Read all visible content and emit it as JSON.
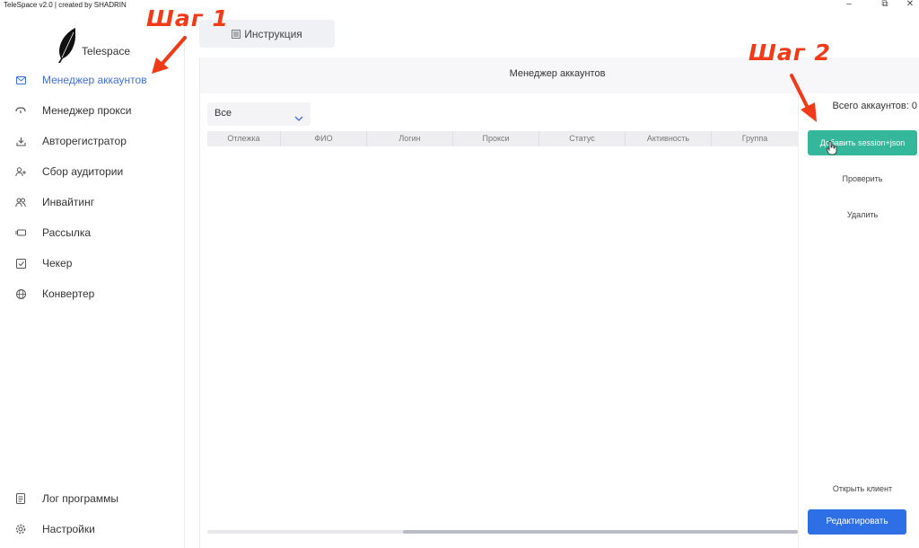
{
  "window": {
    "title": "TeleSpace v2.0 | created by SHADRIN",
    "minimize_glyph": "–",
    "maximize_glyph": "⧉",
    "close_glyph": "✕"
  },
  "app": {
    "name": "Telespace",
    "logo_icon": "feather-icon"
  },
  "top_tab": {
    "label": "Инструкция",
    "icon": "list-icon"
  },
  "sidebar": {
    "items": [
      {
        "label": "Менеджер аккаунтов",
        "icon": "mail-icon",
        "active": true
      },
      {
        "label": "Менеджер прокси",
        "icon": "proxy-icon"
      },
      {
        "label": "Авторегистратор",
        "icon": "download-icon"
      },
      {
        "label": "Сбор аудитории",
        "icon": "add-user-icon"
      },
      {
        "label": "Инвайтинг",
        "icon": "users-icon"
      },
      {
        "label": "Рассылка",
        "icon": "send-icon"
      },
      {
        "label": "Чекер",
        "icon": "checkbox-icon"
      },
      {
        "label": "Конвертер",
        "icon": "globe-icon"
      }
    ],
    "bottom_items": [
      {
        "label": "Лог программы",
        "icon": "log-icon"
      },
      {
        "label": "Настройки",
        "icon": "gear-icon"
      }
    ]
  },
  "main": {
    "title": "Менеджер аккаунтов",
    "filter": {
      "selected": "Все"
    },
    "table": {
      "columns": [
        "Отлежка",
        "ФИО",
        "Логин",
        "Прокси",
        "Статус",
        "Активность",
        "Группа"
      ],
      "rows": []
    }
  },
  "actions": {
    "total_label": "Всего аккаунтов: 0",
    "add_session": "Добавить session+json",
    "check": "Проверить",
    "delete": "Удалить",
    "open_client": "Открыть клиент",
    "edit": "Редактировать"
  },
  "annotations": {
    "step1": "Шаг 1",
    "step2": "Шаг 2",
    "color": "#f03a18"
  },
  "colors": {
    "accent_blue": "#2f6fe6",
    "active_nav": "#3d6fe0",
    "add_button": "#35b79b"
  }
}
